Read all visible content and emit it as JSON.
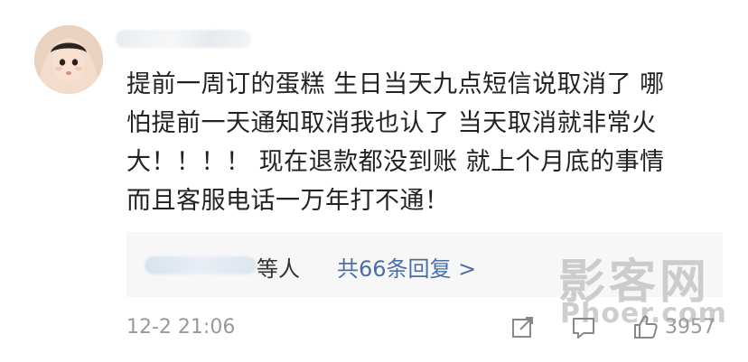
{
  "comment": {
    "lines": [
      "提前一周订的蛋糕 生日当天九点短信说取消了 哪",
      "怕提前一天通知取消我也认了 当天取消就非常火",
      "大！！！！ 现在退款都没到账 就上个月底的事情",
      "而且客服电话一万年打不通！"
    ],
    "reply_people_suffix": "等人",
    "reply_link": "共66条回复 >",
    "timestamp": "12-2 21:06",
    "like_count": "3957"
  },
  "watermark": {
    "main": "影客网",
    "sub": "Phoer.com"
  },
  "colors": {
    "link": "#4a6fa5",
    "meta": "#999999",
    "reply_bg": "#f7f7f7"
  },
  "icons": [
    "avatar",
    "share-icon",
    "comment-icon",
    "like-icon"
  ]
}
